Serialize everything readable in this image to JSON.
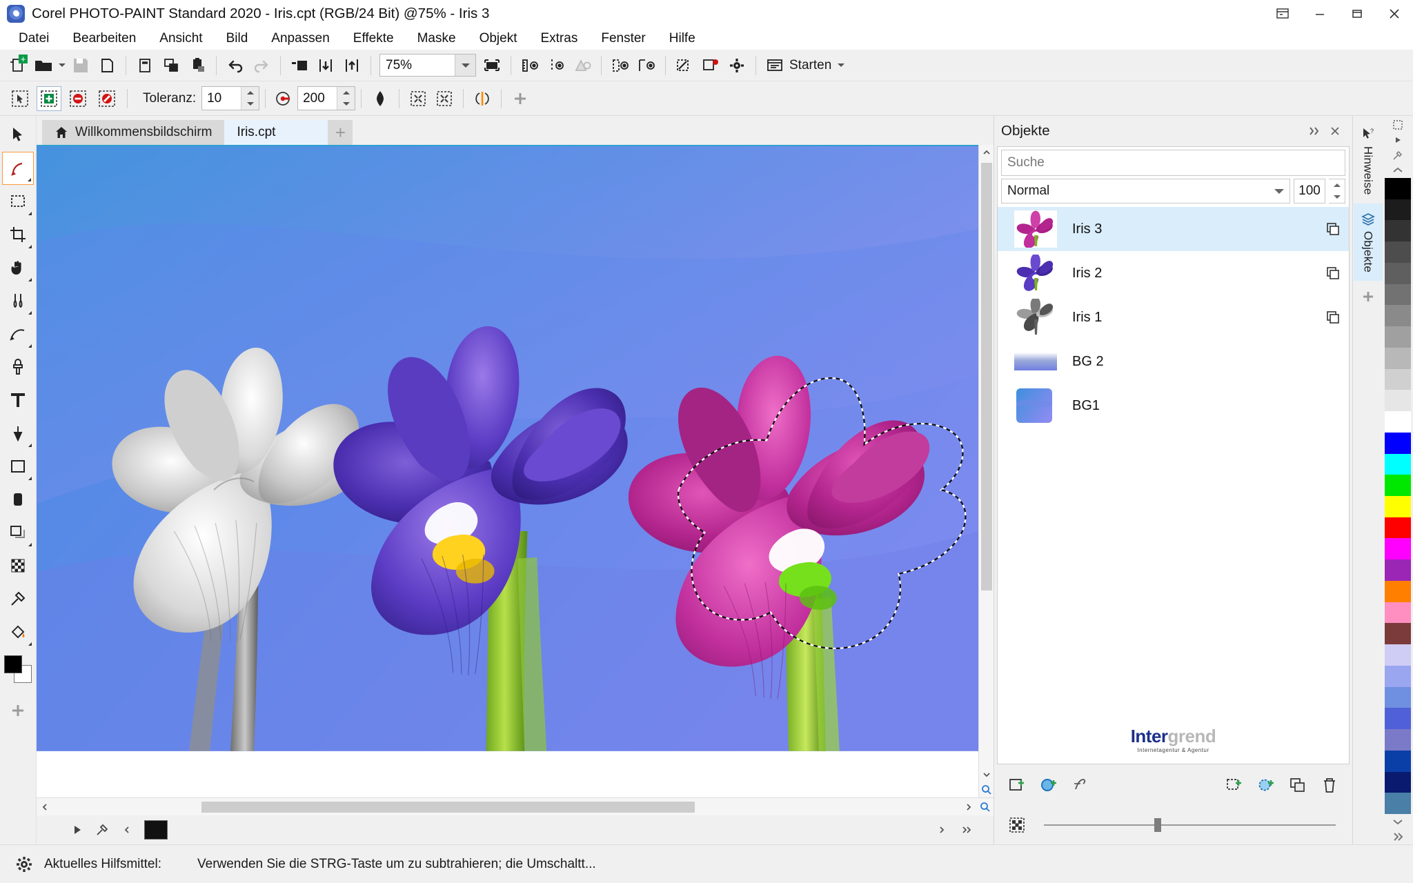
{
  "window": {
    "title": "Corel PHOTO-PAINT Standard 2020 - Iris.cpt (RGB/24 Bit) @75% - Iris 3",
    "app_icon": "corel-photopaint-icon",
    "controls": {
      "restore_down": "restore-icon",
      "minimize": "−",
      "maximize": "▭",
      "close": "✕"
    }
  },
  "menubar": {
    "items": [
      {
        "label": "Datei"
      },
      {
        "label": "Bearbeiten"
      },
      {
        "label": "Ansicht"
      },
      {
        "label": "Bild"
      },
      {
        "label": "Anpassen"
      },
      {
        "label": "Effekte"
      },
      {
        "label": "Maske"
      },
      {
        "label": "Objekt"
      },
      {
        "label": "Extras"
      },
      {
        "label": "Fenster"
      },
      {
        "label": "Hilfe"
      }
    ]
  },
  "toolbar": {
    "zoom_value": "75%",
    "launch_label": "Starten",
    "items": [
      {
        "name": "new-document-icon"
      },
      {
        "name": "open-document-icon"
      },
      {
        "name": "save-icon"
      },
      {
        "name": "print-icon"
      },
      {
        "name": "cut-icon"
      },
      {
        "name": "copy-icon"
      },
      {
        "name": "paste-icon"
      },
      {
        "name": "undo-icon"
      },
      {
        "name": "redo-icon"
      },
      {
        "name": "import-icon"
      },
      {
        "name": "export-icon"
      },
      {
        "name": "publish-pdf-icon"
      },
      {
        "name": "fullscreen-preview-icon"
      },
      {
        "name": "rulers-icon"
      },
      {
        "name": "guidelines-icon"
      },
      {
        "name": "grid-icon"
      },
      {
        "name": "mask-overlay-icon"
      },
      {
        "name": "mask-marquee-icon"
      },
      {
        "name": "clip-mask-icon"
      },
      {
        "name": "record-icon"
      },
      {
        "name": "options-gear-icon"
      }
    ]
  },
  "propertybar": {
    "tolerance_label": "Toleranz:",
    "tolerance_value": "10",
    "feather_value": "200",
    "modes": [
      {
        "name": "mask-normal-icon",
        "active": false
      },
      {
        "name": "mask-add-icon",
        "active": true
      },
      {
        "name": "mask-subtract-icon",
        "active": false
      },
      {
        "name": "mask-xor-icon",
        "active": false
      }
    ],
    "extras": [
      {
        "name": "anti-alias-icon"
      },
      {
        "name": "mask-grow-icon"
      },
      {
        "name": "mask-shrink-icon"
      },
      {
        "name": "mask-feather-icon"
      },
      {
        "name": "add-command-icon"
      }
    ]
  },
  "toolbox": {
    "tools": [
      {
        "name": "pick-tool",
        "selected": false
      },
      {
        "name": "magic-wand-mask-tool",
        "selected": true
      },
      {
        "name": "rectangle-mask-tool",
        "selected": false
      },
      {
        "name": "crop-tool",
        "selected": false
      },
      {
        "name": "pan-tool",
        "selected": false
      },
      {
        "name": "brush-tool",
        "selected": false
      },
      {
        "name": "effect-tool",
        "selected": false
      },
      {
        "name": "clone-tool",
        "selected": false
      },
      {
        "name": "text-tool",
        "selected": false
      },
      {
        "name": "fill-tool",
        "selected": false
      },
      {
        "name": "rectangle-shape-tool",
        "selected": false
      },
      {
        "name": "eraser-tool",
        "selected": false
      },
      {
        "name": "shadow-tool",
        "selected": false
      },
      {
        "name": "transparency-tool",
        "selected": false
      },
      {
        "name": "eyedropper-tool",
        "selected": false
      },
      {
        "name": "paintbucket-tool",
        "selected": false
      }
    ],
    "color_fg": "#000000",
    "color_bg": "#ffffff"
  },
  "tabs": {
    "items": [
      {
        "label": "Willkommensbildschirm",
        "icon": "home-icon",
        "active": false
      },
      {
        "label": "Iris.cpt",
        "icon": "",
        "active": true
      }
    ],
    "add_label": "+"
  },
  "docker": {
    "title": "Objekte",
    "collapse_icon": "double-chevron-right-icon",
    "close_icon": "close-icon",
    "search_placeholder": "Suche",
    "search_value": "",
    "blend_mode": "Normal",
    "opacity": "100",
    "objects": [
      {
        "name": "Iris 3",
        "selected": true,
        "thumb": "iris-magenta-thumb",
        "lock": "lock-transparency-icon"
      },
      {
        "name": "Iris 2",
        "selected": false,
        "thumb": "iris-purple-thumb",
        "lock": "lock-transparency-icon"
      },
      {
        "name": "Iris 1",
        "selected": false,
        "thumb": "iris-grayscale-thumb",
        "lock": "lock-transparency-icon"
      },
      {
        "name": "BG 2",
        "selected": false,
        "thumb": "gradient-bar-thumb",
        "lock": ""
      },
      {
        "name": "BG1",
        "selected": false,
        "thumb": "blue-bg-thumb",
        "lock": ""
      }
    ],
    "brand": {
      "part1": "Inter",
      "part2": "grend",
      "sub": "Internetagentur & Agentur"
    },
    "tools_left": [
      {
        "name": "new-object-icon"
      },
      {
        "name": "new-lens-icon"
      },
      {
        "name": "edit-lens-icon"
      },
      {
        "name": "mask-mode-icon"
      }
    ],
    "tools_right": [
      {
        "name": "new-from-selection-icon"
      },
      {
        "name": "lens-from-selection-icon"
      },
      {
        "name": "duplicate-object-icon"
      },
      {
        "name": "delete-object-icon"
      }
    ]
  },
  "rail": {
    "tabs": [
      {
        "label": "Hinweise",
        "icon": "cursor-question-icon",
        "active": false
      },
      {
        "label": "Objekte",
        "icon": "layers-icon",
        "active": true
      }
    ],
    "add_icon": "plus-icon"
  },
  "palette": {
    "up_icon": "chevron-up-icon",
    "down_icon": "chevron-down-icon",
    "more_icon": "double-chevron-right-icon",
    "swatches": [
      "#000000",
      "#1c1c1c",
      "#333333",
      "#4d4d4d",
      "#5f5f5f",
      "#727272",
      "#8a8a8a",
      "#a0a0a0",
      "#b8b8b8",
      "#d0d0d0",
      "#e6e6e6",
      "#ffffff",
      "#0000ff",
      "#00ffff",
      "#00e800",
      "#ffff00",
      "#ff0000",
      "#ff00ff",
      "#9b26b6",
      "#ff7f00",
      "#ff8fc0",
      "#7b3b3b",
      "#cfcdf5",
      "#9aa6f0",
      "#6f8fe0",
      "#5060d8",
      "#7a7ac8",
      "#0b3fa8",
      "#0a1a6e",
      "#4a7fa8"
    ]
  },
  "statusbar": {
    "gear_icon": "gear-icon",
    "label": "Aktuelles Hilfsmittel:",
    "message": "Verwenden Sie die STRG-Taste um zu subtrahieren; die Umschaltt..."
  },
  "canvas": {
    "document": "Iris.cpt",
    "zoom": "75%",
    "selection_active": true
  }
}
